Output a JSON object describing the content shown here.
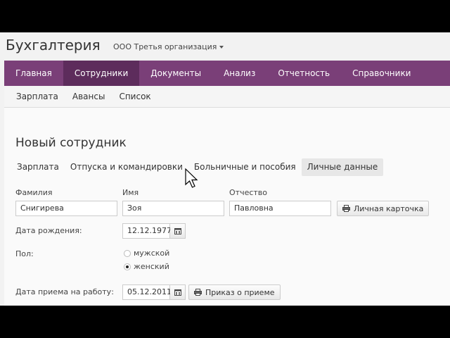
{
  "header": {
    "app_title": "Бухгалтерия",
    "org_name": "ООО Третья организация"
  },
  "main_nav": [
    {
      "label": "Главная"
    },
    {
      "label": "Сотрудники",
      "active": true
    },
    {
      "label": "Документы"
    },
    {
      "label": "Анализ"
    },
    {
      "label": "Отчетность"
    },
    {
      "label": "Справочники"
    }
  ],
  "sub_nav": [
    {
      "label": "Зарплата"
    },
    {
      "label": "Авансы"
    },
    {
      "label": "Список"
    }
  ],
  "page": {
    "title": "Новый сотрудник"
  },
  "tabs": [
    {
      "label": "Зарплата"
    },
    {
      "label": "Отпуска и командировки"
    },
    {
      "label": "Больничные и пособия"
    },
    {
      "label": "Личные данные",
      "active": true
    }
  ],
  "form": {
    "last_name_label": "Фамилия",
    "last_name_value": "Снигирева",
    "first_name_label": "Имя",
    "first_name_value": "Зоя",
    "patronymic_label": "Отчество",
    "patronymic_value": "Павловна",
    "personal_card_button": "Личная карточка",
    "birth_date_label": "Дата рождения:",
    "birth_date_value": "12.12.1977",
    "gender_label": "Пол:",
    "gender_options": [
      "мужской",
      "женский"
    ],
    "gender_selected": "женский",
    "hire_date_label": "Дата приема на работу:",
    "hire_date_value": "05.12.2011",
    "hire_order_button": "Приказ о приеме"
  },
  "colors": {
    "nav_bg": "#7a3f78",
    "nav_active_bg": "#5d2c5c"
  },
  "icons": {
    "print": "printer-icon",
    "calendar": "calendar-icon",
    "dropdown": "chevron-down-icon"
  }
}
